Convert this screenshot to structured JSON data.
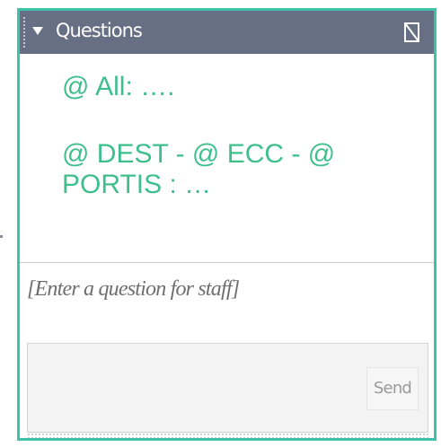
{
  "panel": {
    "title": "Questions",
    "icons": {
      "collapse": "triangle-down-icon",
      "popout": "popout-icon"
    },
    "accent_color": "#3fc2a7",
    "header_color": "#676f84"
  },
  "messages": [
    {
      "text": "@ All: …."
    },
    {
      "text": "@ DEST - @ ECC - @ PORTIS : …"
    }
  ],
  "message_color": "#3fbf8d",
  "question_input": {
    "placeholder": "[Enter a question for staff]",
    "value": ""
  },
  "compose": {
    "send_label": "Send"
  }
}
